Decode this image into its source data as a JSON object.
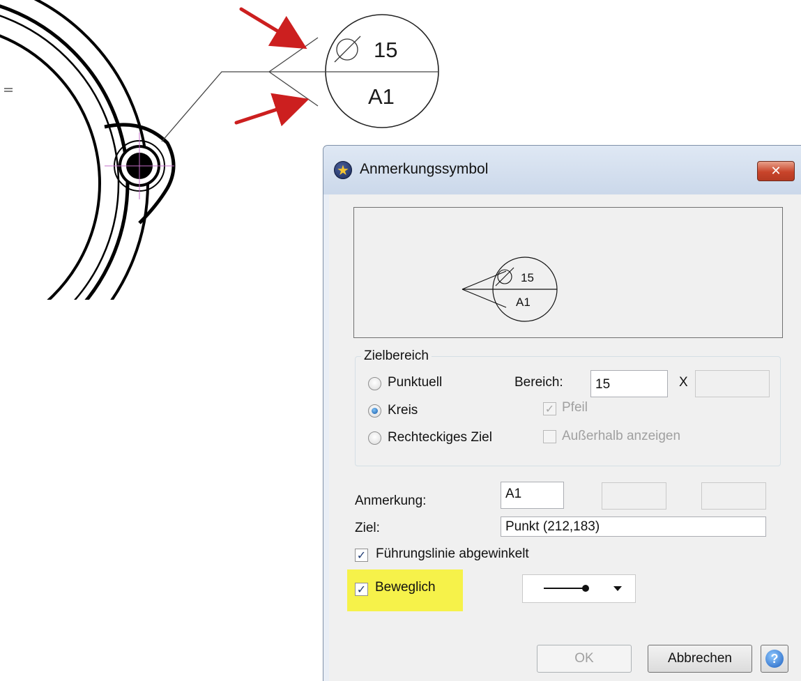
{
  "drawing": {
    "diameter_symbol": "∅",
    "size_value": "15",
    "note_label": "A1"
  },
  "dialog": {
    "title": "Anmerkungssymbol",
    "close_glyph": "✕",
    "preview": {
      "diameter_symbol": "∅",
      "size_value": "15",
      "note_label": "A1"
    },
    "target_area": {
      "group_label": "Zielbereich",
      "options": [
        {
          "label": "Punktuell",
          "checked": false
        },
        {
          "label": "Kreis",
          "checked": true
        },
        {
          "label": "Rechteckiges Ziel",
          "checked": false
        }
      ],
      "range_label": "Bereich:",
      "range_value": "15",
      "range_separator": "X",
      "range_value2": "",
      "arrow_label": "Pfeil",
      "arrow_checked": true,
      "show_outside_label": "Außerhalb anzeigen",
      "show_outside_checked": false
    },
    "note_label": "Anmerkung:",
    "note_value": "A1",
    "note_extra1": "",
    "note_extra2": "",
    "target_label": "Ziel:",
    "target_value": "Punkt (212,183)",
    "angled_leader_label": "Führungslinie abgewinkelt",
    "angled_leader_checked": true,
    "movable_label": "Beweglich",
    "movable_checked": true,
    "leader_style_icon": "dot-leader-line-icon",
    "ok_label": "OK",
    "cancel_label": "Abbrechen",
    "help_glyph": "?"
  },
  "colors": {
    "highlight": "#f6f24a",
    "arrow": "#cc1f1f",
    "crosshair": "#c36ec9",
    "close_button": "#c8442a"
  }
}
